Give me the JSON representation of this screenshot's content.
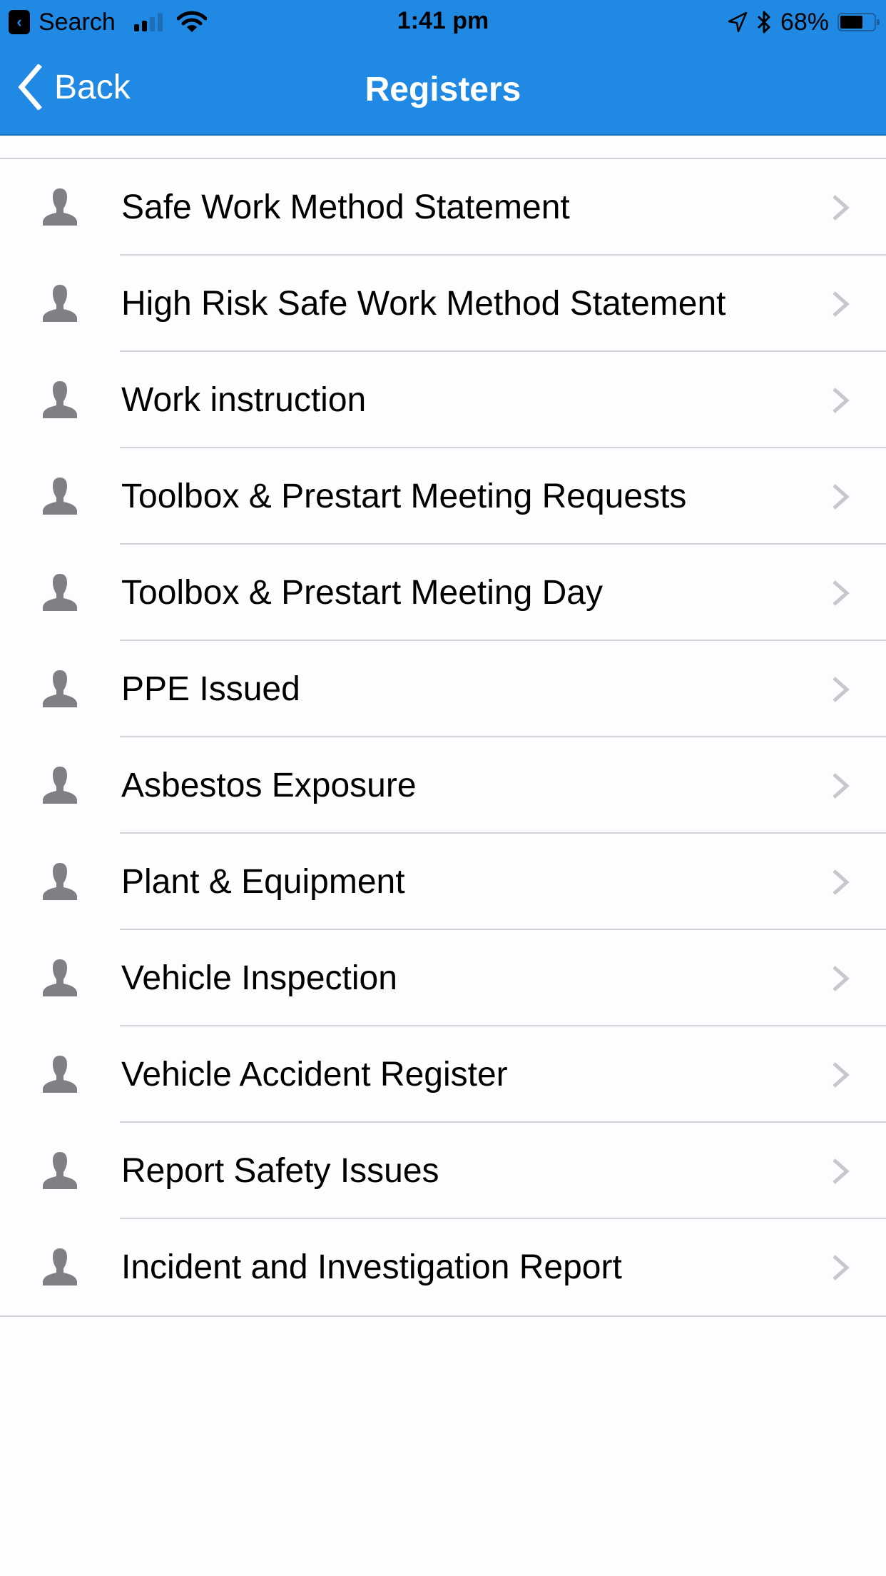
{
  "status_bar": {
    "back_app_label": "Search",
    "time": "1:41 pm",
    "battery_percent_label": "68%",
    "battery_level": 0.68,
    "signal_bars_active": 2,
    "signal_bars_total": 4,
    "icons": [
      "app-back-icon",
      "signal-icon",
      "wifi-icon",
      "location-icon",
      "bluetooth-icon",
      "battery-icon"
    ]
  },
  "nav": {
    "back_label": "Back",
    "title": "Registers"
  },
  "colors": {
    "header_bg": "#2089e3",
    "icon_gray": "#7f7f84",
    "chevron_gray": "#c7c7cc",
    "separator": "#d4d4d8"
  },
  "list": {
    "items": [
      {
        "label": "Safe Work Method Statement",
        "icon": "person-icon"
      },
      {
        "label": "High Risk Safe Work Method Statement",
        "icon": "person-icon"
      },
      {
        "label": "Work instruction",
        "icon": "person-icon"
      },
      {
        "label": "Toolbox & Prestart Meeting Requests",
        "icon": "person-icon"
      },
      {
        "label": "Toolbox & Prestart Meeting Day",
        "icon": "person-icon"
      },
      {
        "label": "PPE Issued",
        "icon": "person-icon"
      },
      {
        "label": "Asbestos Exposure",
        "icon": "person-icon"
      },
      {
        "label": "Plant & Equipment",
        "icon": "person-icon"
      },
      {
        "label": "Vehicle Inspection",
        "icon": "person-icon"
      },
      {
        "label": "Vehicle Accident Register",
        "icon": "person-icon"
      },
      {
        "label": "Report Safety Issues",
        "icon": "person-icon"
      },
      {
        "label": "Incident and Investigation Report",
        "icon": "person-icon"
      }
    ]
  }
}
